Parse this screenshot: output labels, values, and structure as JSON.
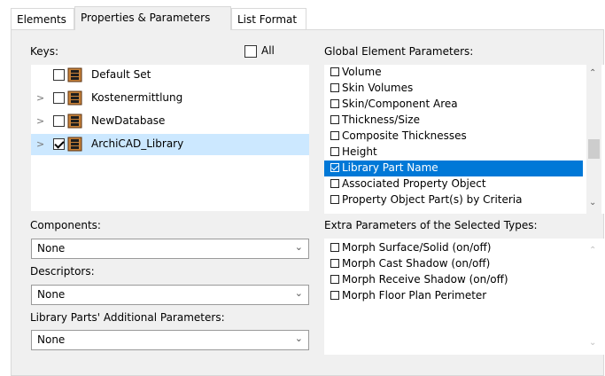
{
  "tabs": [
    {
      "label": "Elements",
      "active": false
    },
    {
      "label": "Properties & Parameters",
      "active": true
    },
    {
      "label": "List Format",
      "active": false
    }
  ],
  "keys": {
    "label": "Keys:",
    "all_label": "All",
    "all_checked": false,
    "items": [
      {
        "label": "Default Set",
        "checked": false,
        "expandable": false,
        "selected": false
      },
      {
        "label": "Kostenermittlung",
        "checked": false,
        "expandable": true,
        "selected": false
      },
      {
        "label": "NewDatabase",
        "checked": false,
        "expandable": true,
        "selected": false
      },
      {
        "label": "ArchiCAD_Library",
        "checked": true,
        "expandable": true,
        "selected": true
      }
    ]
  },
  "components": {
    "label": "Components:",
    "value": "None"
  },
  "descriptors": {
    "label": "Descriptors:",
    "value": "None"
  },
  "library_params": {
    "label": "Library Parts' Additional Parameters:",
    "value": "None"
  },
  "global_params": {
    "label": "Global Element Parameters:",
    "items": [
      {
        "label": "Volume",
        "checked": false,
        "selected": false
      },
      {
        "label": "Skin Volumes",
        "checked": false,
        "selected": false
      },
      {
        "label": "Skin/Component Area",
        "checked": false,
        "selected": false
      },
      {
        "label": "Thickness/Size",
        "checked": false,
        "selected": false
      },
      {
        "label": "Composite Thicknesses",
        "checked": false,
        "selected": false
      },
      {
        "label": "Height",
        "checked": false,
        "selected": false
      },
      {
        "label": "Library Part Name",
        "checked": true,
        "selected": true
      },
      {
        "label": "Associated Property Object",
        "checked": false,
        "selected": false
      },
      {
        "label": "Property Object Part(s) by Criteria",
        "checked": false,
        "selected": false
      }
    ]
  },
  "extra_params": {
    "label": "Extra Parameters of the Selected Types:",
    "items": [
      {
        "label": "Morph Surface/Solid (on/off)",
        "checked": false
      },
      {
        "label": "Morph Cast Shadow  (on/off)",
        "checked": false
      },
      {
        "label": "Morph Receive Shadow (on/off)",
        "checked": false
      },
      {
        "label": "Morph Floor Plan Perimeter",
        "checked": false
      }
    ]
  },
  "colors": {
    "panel_bg": "#f0f0f0",
    "selection_blue": "#0078d7",
    "tree_selection": "#cce8ff",
    "db_icon": "#c8823a"
  },
  "icons": {
    "expand": "chevron-right-icon",
    "combo": "chevron-down-icon",
    "database": "database-icon"
  }
}
